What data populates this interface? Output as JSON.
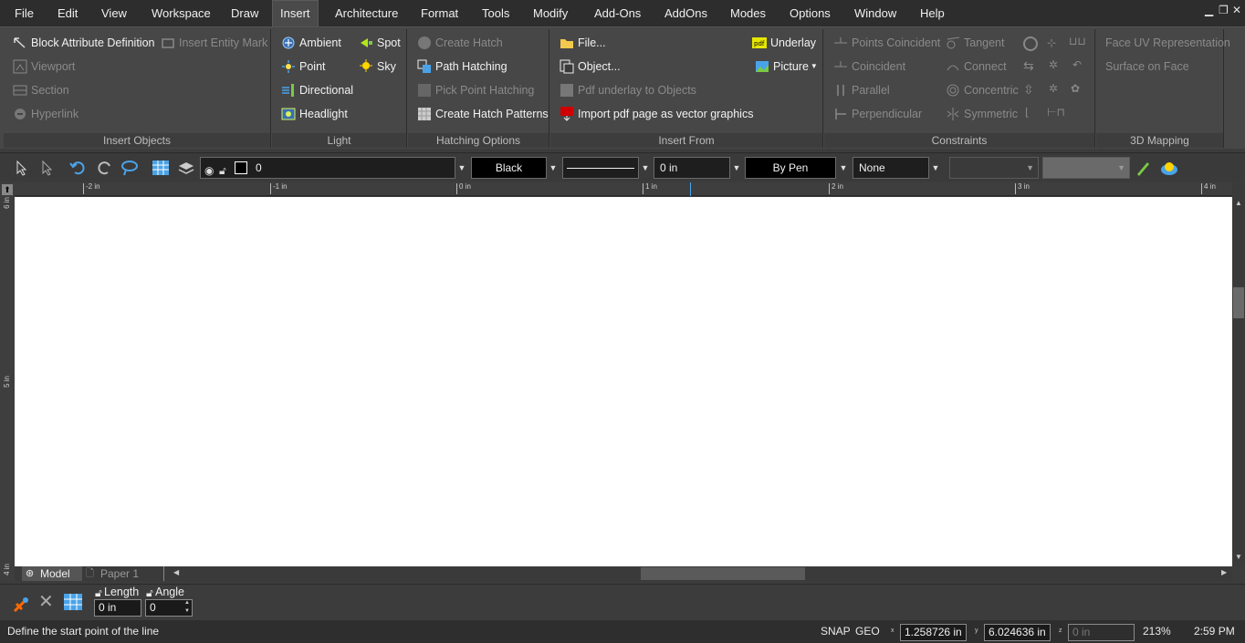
{
  "menu": [
    "File",
    "Edit",
    "View",
    "Workspace",
    "Draw",
    "Insert",
    "Architecture",
    "Format",
    "Tools",
    "Modify",
    "Add-Ons",
    "AddOns",
    "Modes",
    "Options",
    "Window",
    "Help"
  ],
  "active_menu": "Insert",
  "ribbon": {
    "insert_objects": {
      "label": "Insert Objects",
      "block_attr": "Block Attribute Definition",
      "insert_entity_mark": "Insert Entity Mark",
      "viewport": "Viewport",
      "section": "Section",
      "hyperlink": "Hyperlink"
    },
    "light": {
      "label": "Light",
      "ambient": "Ambient",
      "spot": "Spot",
      "point": "Point",
      "sky": "Sky",
      "directional": "Directional",
      "headlight": "Headlight"
    },
    "hatching": {
      "label": "Hatching Options",
      "create_hatch": "Create Hatch",
      "path_hatching": "Path Hatching",
      "pick_point": "Pick Point Hatching",
      "create_patterns": "Create Hatch Patterns"
    },
    "insert_from": {
      "label": "Insert From",
      "file": "File...",
      "object": "Object...",
      "pdf_underlay": "Pdf underlay to Objects",
      "import_pdf": "Import pdf page as vector graphics",
      "underlay": "Underlay",
      "picture": "Picture"
    },
    "constraints": {
      "label": "Constraints",
      "points_coincident": "Points Coincident",
      "coincident": "Coincident",
      "parallel": "Parallel",
      "perpendicular": "Perpendicular",
      "tangent": "Tangent",
      "connect": "Connect",
      "concentric": "Concentric",
      "symmetric": "Symmetric"
    },
    "mapping": {
      "label": "3D Mapping",
      "face_uv": "Face UV Representation",
      "surface_on_face": "Surface on Face"
    }
  },
  "toolbar": {
    "layer_value": "0",
    "color_value": "Black",
    "line_width": "0 in",
    "pen": "By Pen",
    "fill": "None"
  },
  "ruler": {
    "h_labels": [
      "-2 in",
      "-1 in",
      "0 in",
      "1 in",
      "2 in",
      "3 in",
      "4 in"
    ],
    "v_labels": [
      "6 in",
      "5 in",
      "4 in"
    ]
  },
  "tabs": [
    "Model",
    "Paper 1"
  ],
  "command": {
    "length_label": "Length",
    "length_value": "0 in",
    "angle_label": "Angle",
    "angle_value": "0"
  },
  "status": {
    "prompt": "Define the start point of the line",
    "snap": "SNAP",
    "geo": "GEO",
    "x_label": "x",
    "y_label": "y",
    "z_label": "z",
    "x": "1.258726 in",
    "y": "6.024636 in",
    "z": "0 in",
    "zoom": "213%",
    "time": "2:59 PM"
  },
  "colors": {
    "accent": "#4aa3e8",
    "canvas": "#ffffff",
    "ribbon_bg": "#474747"
  }
}
